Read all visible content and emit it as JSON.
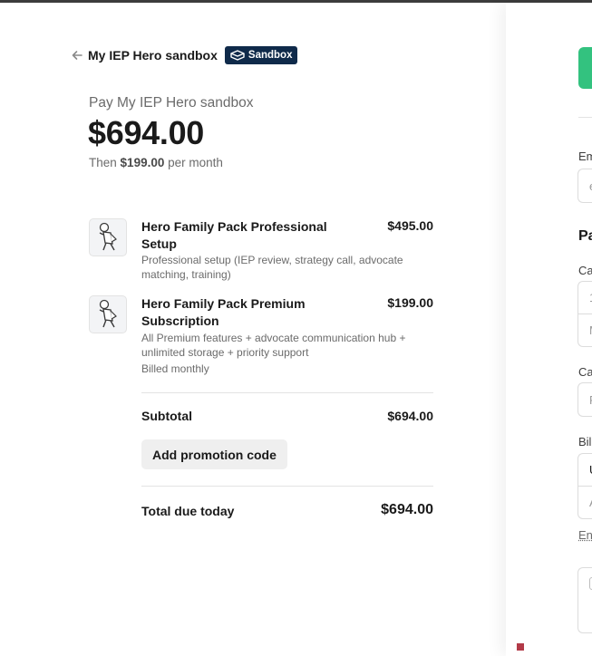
{
  "header": {
    "merchant": "My IEP Hero sandbox",
    "badge": "Sandbox"
  },
  "summary": {
    "pay_label": "Pay My IEP Hero sandbox",
    "amount": "$694.00",
    "then_prefix": "Then",
    "then_amount": "$199.00",
    "then_suffix": "per month"
  },
  "items": [
    {
      "name": "Hero Family Pack Professional Setup",
      "price": "$495.00",
      "description": "Professional setup (IEP review, strategy call, advocate matching, training)"
    },
    {
      "name": "Hero Family Pack Premium Subscription",
      "price": "$199.00",
      "description": "All Premium features + advocate communication hub + unlimited storage + priority support",
      "billed": "Billed monthly"
    }
  ],
  "totals": {
    "subtotal_label": "Subtotal",
    "subtotal_value": "$694.00",
    "promo_label": "Add promotion code",
    "total_label": "Total due today",
    "total_value": "$694.00"
  },
  "right_panel": {
    "email_label": "Em",
    "email_placeholder": "e",
    "payment_heading": "Pa",
    "card_info_label": "Ca",
    "card_number_placeholder": "1",
    "card_expiry_placeholder": "M",
    "cardholder_label": "Ca",
    "cardholder_placeholder": "F",
    "billing_label": "Bil",
    "country_value": "U",
    "address_placeholder": "A",
    "manual_link": "Ent"
  },
  "colors": {
    "badge_bg": "#0f2a4a",
    "pay_button": "#33c27f"
  }
}
